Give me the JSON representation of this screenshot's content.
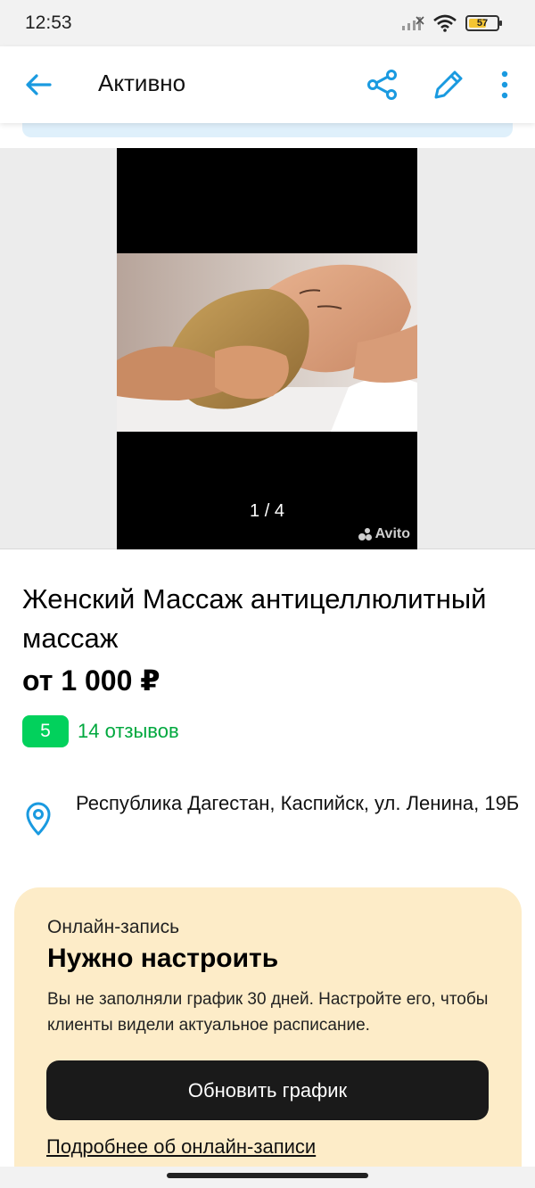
{
  "status_bar": {
    "time": "12:53",
    "battery": "57",
    "icons": [
      "signal-icon",
      "wifi-icon",
      "battery-icon"
    ]
  },
  "toolbar": {
    "title": "Активно",
    "icons": [
      "back-arrow-icon",
      "share-icon",
      "edit-pencil-icon",
      "more-vertical-icon"
    ],
    "accent_color": "#1a9ae0"
  },
  "gallery": {
    "counter": "1 / 4",
    "watermark": "Avito"
  },
  "listing": {
    "title": "Женский Массаж антицеллюлитный массаж",
    "price": "от 1 000 ₽",
    "rating": "5",
    "reviews": "14 отзывов",
    "address": "Республика Дагестан, Каспийск, ул. Ленина, 19Б",
    "rating_color": "#02d15c"
  },
  "booking": {
    "label": "Онлайн-запись",
    "status": "Нужно настроить",
    "description": "Вы не заполняли график 30 дней. Настройте его, чтобы клиенты видели актуальное расписание.",
    "button": "Обновить график",
    "link": "Подробнее об онлайн-записи",
    "background": "#fdecc8"
  }
}
